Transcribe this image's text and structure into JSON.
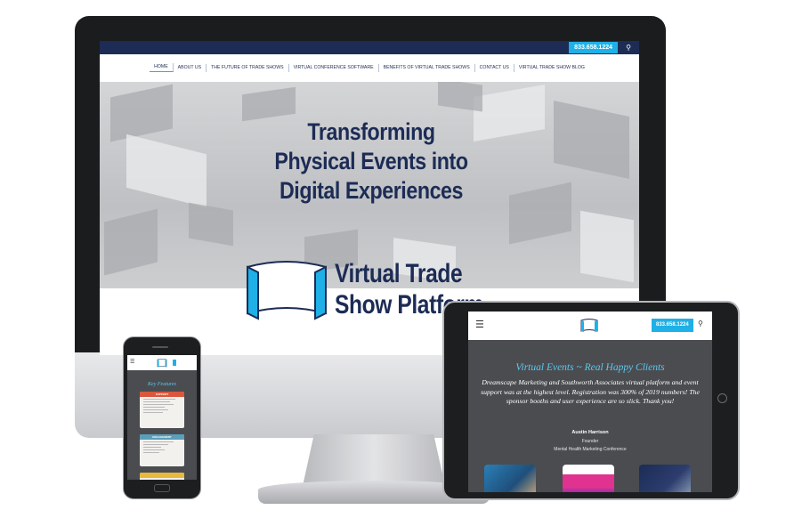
{
  "desktop": {
    "phone_number": "833.658.1224",
    "nav": [
      "HOME",
      "ABOUT US",
      "THE FUTURE OF TRADE SHOWS",
      "VIRTUAL CONFERENCE SOFTWARE",
      "BENEFITS OF VIRTUAL TRADE SHOWS",
      "CONTACT US",
      "VIRTUAL TRADE SHOW BLOG"
    ],
    "hero_title": [
      "Transforming",
      "Physical Events into",
      "Digital Experiences"
    ],
    "logo_text": [
      "Virtual Trade",
      "Show Platform"
    ]
  },
  "tablet": {
    "phone_number": "833.658.1224",
    "heading": "Virtual Events ~ Real Happy Clients",
    "quote": "Dreamscape Marketing and Southworth Associates virtual platform and event support was at the highest level. Registration was 300% of 2019 numbers! The sponsor booths and user experience are so slick. Thank you!",
    "name": "Austin Harrison",
    "role": "Founder",
    "org": "Mental Health Marketing Conference"
  },
  "phone": {
    "title": "Key Features",
    "card1_header": "SUPPORT",
    "card2_header": "ENGAGEMENT"
  },
  "colors": {
    "navy": "#1c2c55",
    "accent_blue": "#1eb0e6",
    "dark_gray": "#4a4c50",
    "heading_blue": "#5ec8f0",
    "card_red": "#d9573c",
    "card_teal": "#5a9fb9",
    "card_yellow": "#e8b93a"
  }
}
